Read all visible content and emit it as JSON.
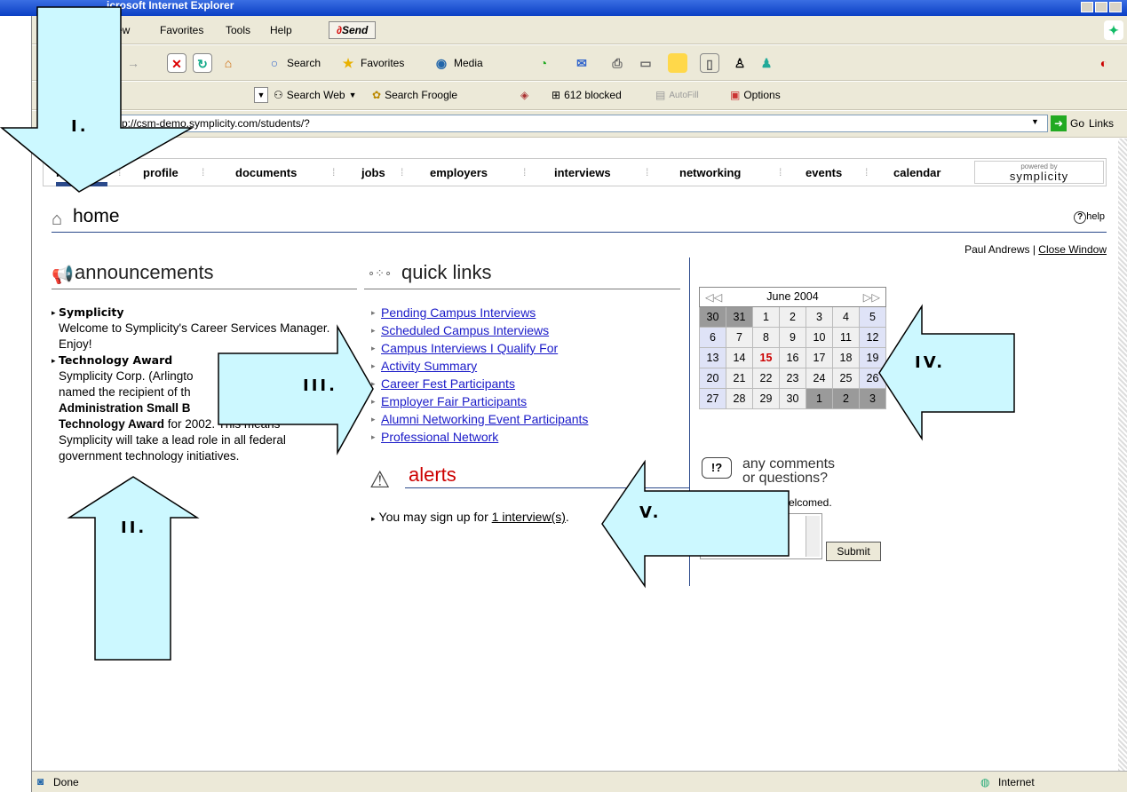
{
  "window": {
    "title": "icrosoft Internet Explorer"
  },
  "menu": {
    "items": [
      "ew",
      "Favorites",
      "Tools",
      "Help"
    ],
    "send": "Send"
  },
  "toolbar": {
    "search": "Search",
    "favorites": "Favorites",
    "media": "Media"
  },
  "googlebar": {
    "search_web": "Search Web",
    "search_froogle": "Search Froogle",
    "blocked": "612 blocked",
    "autofill": "AutoFill",
    "options": "Options"
  },
  "address": {
    "url": "p://csm-demo.symplicity.com/students/?",
    "go": "Go",
    "links": "Links"
  },
  "nav": {
    "items": [
      "home",
      "profile",
      "documents",
      "jobs",
      "employers",
      "interviews",
      "networking",
      "events",
      "calendar"
    ],
    "powered_by": "powered by",
    "brand": "symplicity"
  },
  "page": {
    "title": "home",
    "help": "help",
    "user": "Paul Andrews",
    "close": "Close Window"
  },
  "announcements": {
    "title": "announcements",
    "items": [
      {
        "heading": "Symplicity",
        "body": "Welcome to Symplicity's Career Services Manager. Enjoy!"
      },
      {
        "heading": "Technology Award",
        "body_pre": "Symplicity Corp. (Arlingto",
        "body_2": "named the recipient of th",
        "bold_1": "Administration Small B",
        "bold_2": "Technology Award",
        "body_post": "for 2002. This means",
        "body_3": "Symplicity will take a lead role in all federal",
        "body_4": "government technology initiatives."
      }
    ]
  },
  "quick_links": {
    "title": "quick links",
    "items": [
      "Pending Campus Interviews",
      "Scheduled Campus Interviews",
      "Campus Interviews I Qualify For",
      "Activity Summary",
      "Career Fest Participants",
      "Employer Fair Participants",
      "Alumni Networking Event Participants",
      "Professional Network"
    ]
  },
  "alerts": {
    "title": "alerts",
    "text": "You may sign up for",
    "link": "1 interview(s)",
    "suffix": "."
  },
  "calendar": {
    "month": "June 2004",
    "weeks": [
      [
        "30",
        "31",
        "1",
        "2",
        "3",
        "4",
        "5"
      ],
      [
        "6",
        "7",
        "8",
        "9",
        "10",
        "11",
        "12"
      ],
      [
        "13",
        "14",
        "15",
        "16",
        "17",
        "18",
        "19"
      ],
      [
        "20",
        "21",
        "22",
        "23",
        "24",
        "25",
        "26"
      ],
      [
        "27",
        "28",
        "29",
        "30",
        "1",
        "2",
        "3"
      ]
    ],
    "today": "15"
  },
  "comments": {
    "title_1": "any comments",
    "title_2": "or questions?",
    "welcome": "s welcomed.",
    "submit": "Submit"
  },
  "annotations": {
    "i": "I.",
    "ii": "II.",
    "iii": "III.",
    "iv": "IV.",
    "v": "V."
  },
  "status": {
    "left": "Done",
    "zone": "Internet"
  },
  "colors": {
    "arrow_fill": "#ccf8ff",
    "nav_accent": "#2b4a8b",
    "alert_red": "#cc0000",
    "link_blue": "#1a1ac8"
  }
}
